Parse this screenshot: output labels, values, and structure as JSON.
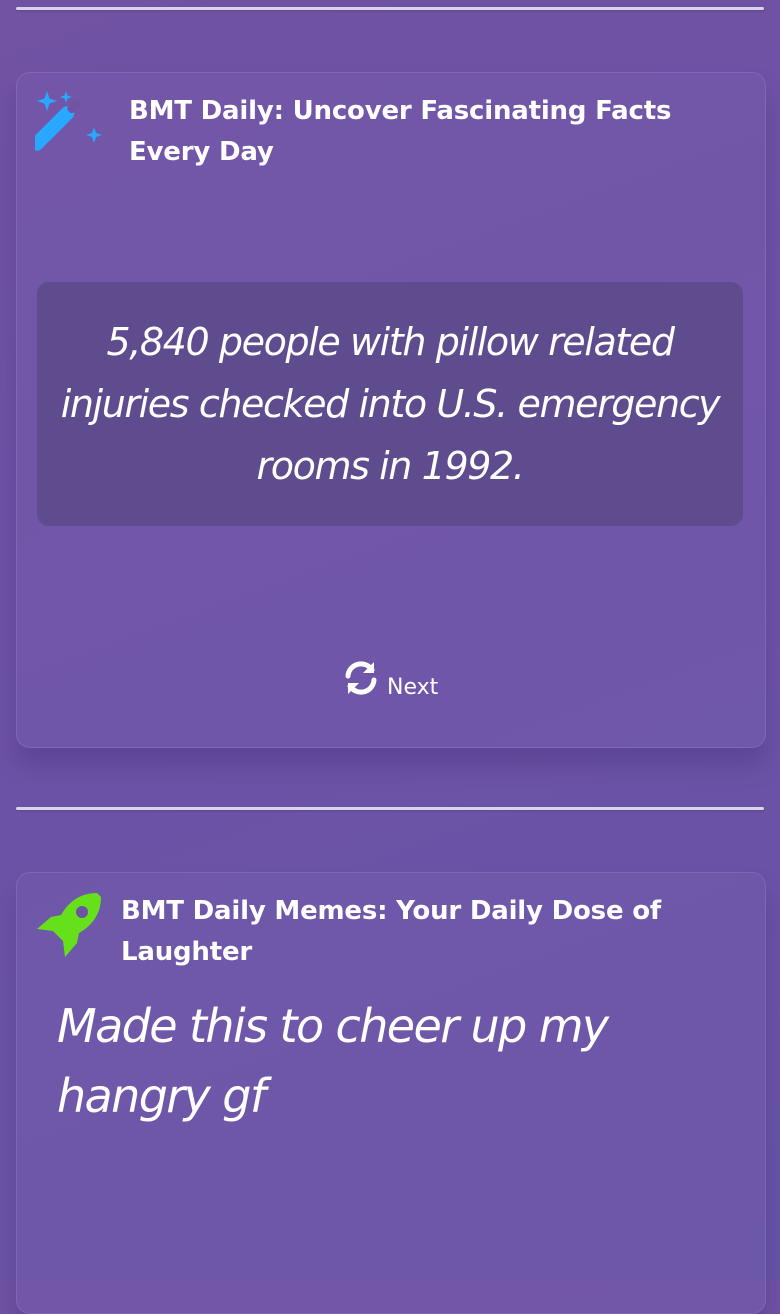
{
  "fact_card": {
    "title": "BMT Daily: Uncover Fascinating Facts Every Day",
    "icon": "magic-wand-icon",
    "icon_color": "#29a8ff",
    "fact": "5,840 people with pillow related injuries checked into U.S. emergency rooms in 1992.",
    "next_label": "Next",
    "next_icon": "refresh-icon"
  },
  "meme_card": {
    "title": "BMT Daily Memes: Your Daily Dose of Laughter",
    "icon": "rocket-icon",
    "icon_color": "#66e01a",
    "caption": "Made this to cheer up my hangry gf"
  }
}
